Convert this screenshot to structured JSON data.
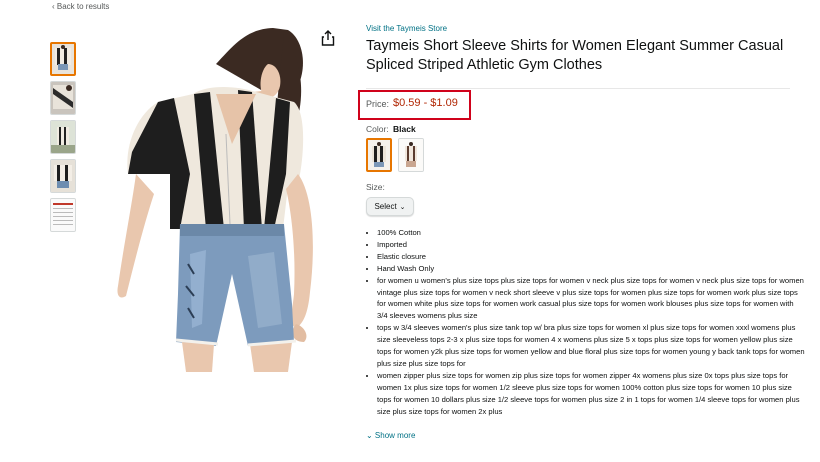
{
  "nav": {
    "back": "‹ Back to results"
  },
  "product": {
    "store": "Visit the Taymeis Store",
    "title": "Taymeis Short Sleeve Shirts for Women Elegant Summer Casual Spliced Striped Athletic Gym Clothes",
    "price_label": "Price:",
    "price": "$0.59 - $1.09",
    "color_label": "Color:",
    "color_value": "Black",
    "size_label": "Size:",
    "size_select": "Select",
    "bullets": [
      "100% Cotton",
      "Imported",
      "Elastic closure",
      "Hand Wash Only",
      "for women u women's plus size tops plus size tops for women v neck plus size tops for women v neck plus size tops for women vintage plus size tops for women v neck short sleeve v plus size tops for women plus size tops for women work plus size tops for women white plus size tops for women work casual plus size tops for women work blouses plus size tops for women with 3/4 sleeves womens plus size",
      "tops w 3/4 sleeves women's plus size tank top w/ bra plus size tops for women xl plus size tops for women xxxl womens plus size sleeveless tops 2-3 x plus size tops for women 4 x womens plus size 5 x tops plus size tops for women yellow plus size tops for women y2k plus size tops for women yellow and blue floral plus size tops for women young y back tank tops for women plus size plus size tops for",
      "women zipper plus size tops for women zip plus size tops for women zipper 4x womens plus size 0x tops plus size tops for women 1x plus size tops for women 1/2 sleeve plus size tops for women 100% cotton plus size tops for women 10 plus size tops for women 10 dollars plus size 1/2 sleeve tops for women plus size 2 in 1 tops for women 1/4 sleeve tops for women plus size plus size tops for women 2x plus"
    ],
    "show_more": "⌄ Show more"
  },
  "colors": {
    "price": "#b12704",
    "link": "#007185",
    "highlight_box": "#d0021b",
    "selected_border": "#e77600"
  }
}
